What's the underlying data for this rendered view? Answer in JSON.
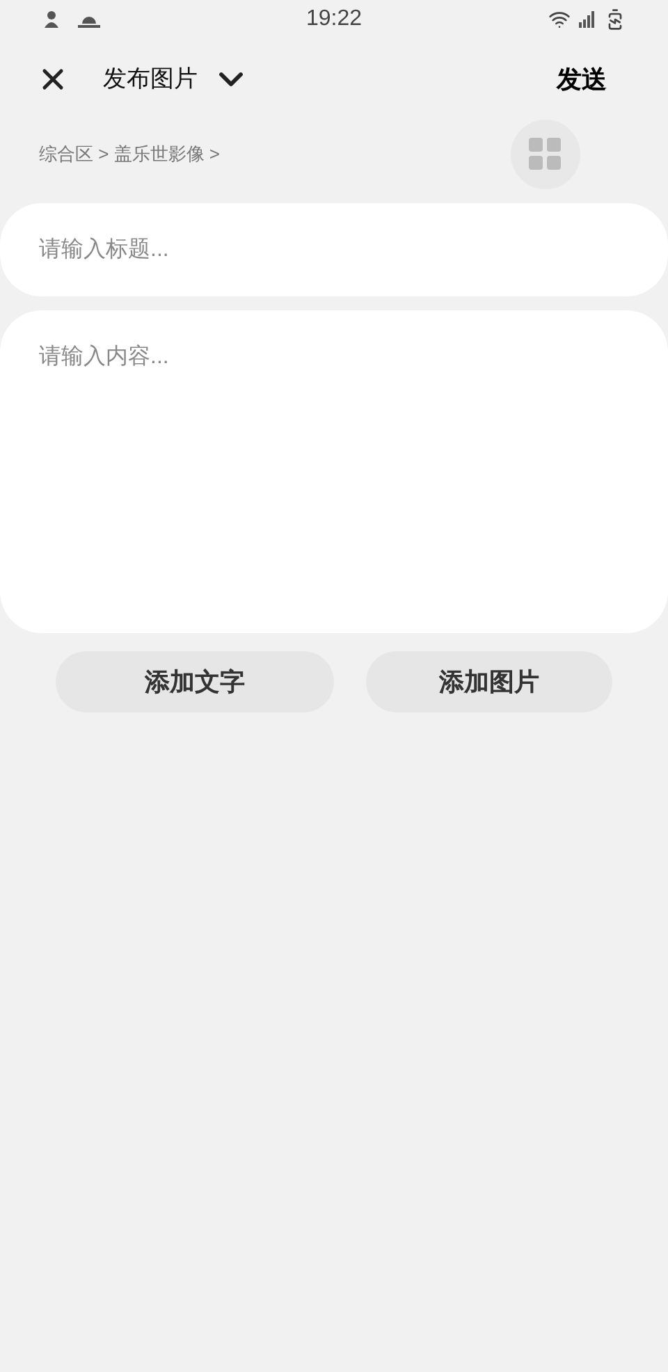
{
  "status_bar": {
    "time": "19:22"
  },
  "header": {
    "title": "发布图片",
    "send": "发送"
  },
  "breadcrumb": {
    "text": "综合区 > 盖乐世影像 >"
  },
  "title_field": {
    "placeholder": "请输入标题..."
  },
  "content_field": {
    "placeholder": "请输入内容..."
  },
  "buttons": [
    "添加文字",
    "添加图片"
  ]
}
